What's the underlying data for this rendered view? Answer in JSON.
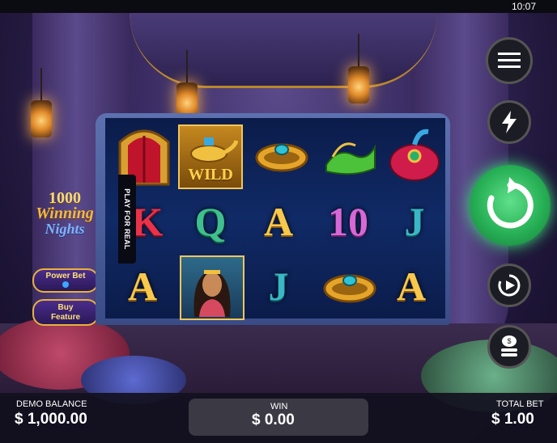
{
  "status_bar": {
    "time": "10:07"
  },
  "game": {
    "title_line1": "1000",
    "title_line2": "Winning",
    "title_line3": "Nights"
  },
  "side_buttons": {
    "power_bet_label": "Power Bet",
    "buy_feature_line1": "Buy",
    "buy_feature_line2": "Feature"
  },
  "play_for_real_label": "PLAY FOR REAL",
  "reels": {
    "grid": [
      [
        "palace-door",
        "lamp-wild",
        "gold-bracelet",
        "green-slippers",
        "red-turban"
      ],
      [
        "K",
        "Q",
        "A",
        "10",
        "J"
      ],
      [
        "A",
        "princess",
        "J",
        "gold-bracelet",
        "A"
      ]
    ],
    "letters": {
      "r1c0": "K",
      "r1c1": "Q",
      "r1c2": "A",
      "r1c3": "10",
      "r1c4": "J",
      "r2c0": "A",
      "r2c2": "J",
      "r2c4": "A"
    },
    "wild_label": "WILD"
  },
  "controls": {
    "menu_icon": "hamburger-menu-icon",
    "turbo_icon": "lightning-icon",
    "spin_icon": "spin-arrow-icon",
    "autoplay_icon": "autoplay-icon",
    "bet_icon": "coin-stack-icon"
  },
  "bottom_bar": {
    "balance_label": "DEMO BALANCE",
    "balance_value": "$ 1,000.00",
    "win_label": "WIN",
    "win_value": "$ 0.00",
    "bet_label": "TOTAL BET",
    "bet_value": "$ 1.00"
  },
  "colors": {
    "spin_button": "#27b056",
    "reel_background": "#102a66",
    "gold_accent": "#e8b23c"
  }
}
